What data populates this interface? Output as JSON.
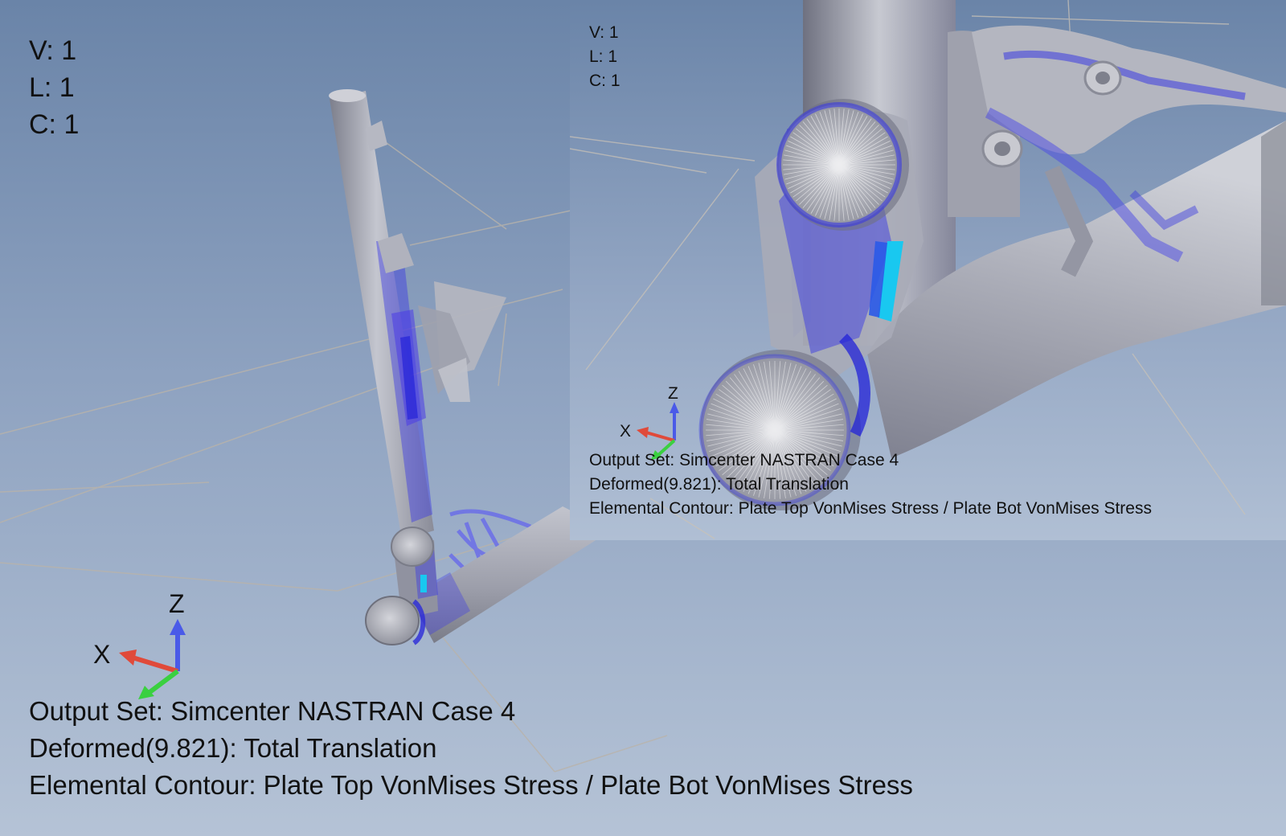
{
  "main_view": {
    "vlc": {
      "v": "V: 1",
      "l": "L: 1",
      "c": "C: 1"
    },
    "triad": {
      "x_label": "X",
      "z_label": "Z"
    },
    "info": {
      "output_set": "Output Set: Simcenter NASTRAN Case 4",
      "deformed": "Deformed(9.821): Total Translation",
      "contour": "Elemental Contour: Plate Top VonMises Stress / Plate Bot VonMises Stress"
    }
  },
  "inset_view": {
    "vlc": {
      "v": "V: 1",
      "l": "L: 1",
      "c": "C: 1"
    },
    "triad": {
      "x_label": "X",
      "z_label": "Z"
    },
    "info": {
      "output_set": "Output Set: Simcenter NASTRAN Case 4",
      "deformed": "Deformed(9.821): Total Translation",
      "contour": "Elemental Contour: Plate Top VonMises Stress / Plate Bot VonMises Stress"
    }
  },
  "colors": {
    "background_top": "#6a84a8",
    "background_bottom": "#b5c3d6",
    "model_gray": "#a6a8b4",
    "stress_blue": "#3a3ae0",
    "stress_cyan": "#19c8f0",
    "axis_x_red": "#e04a3a",
    "axis_y_green": "#3ad040",
    "axis_z_blue": "#4a5ae8"
  }
}
